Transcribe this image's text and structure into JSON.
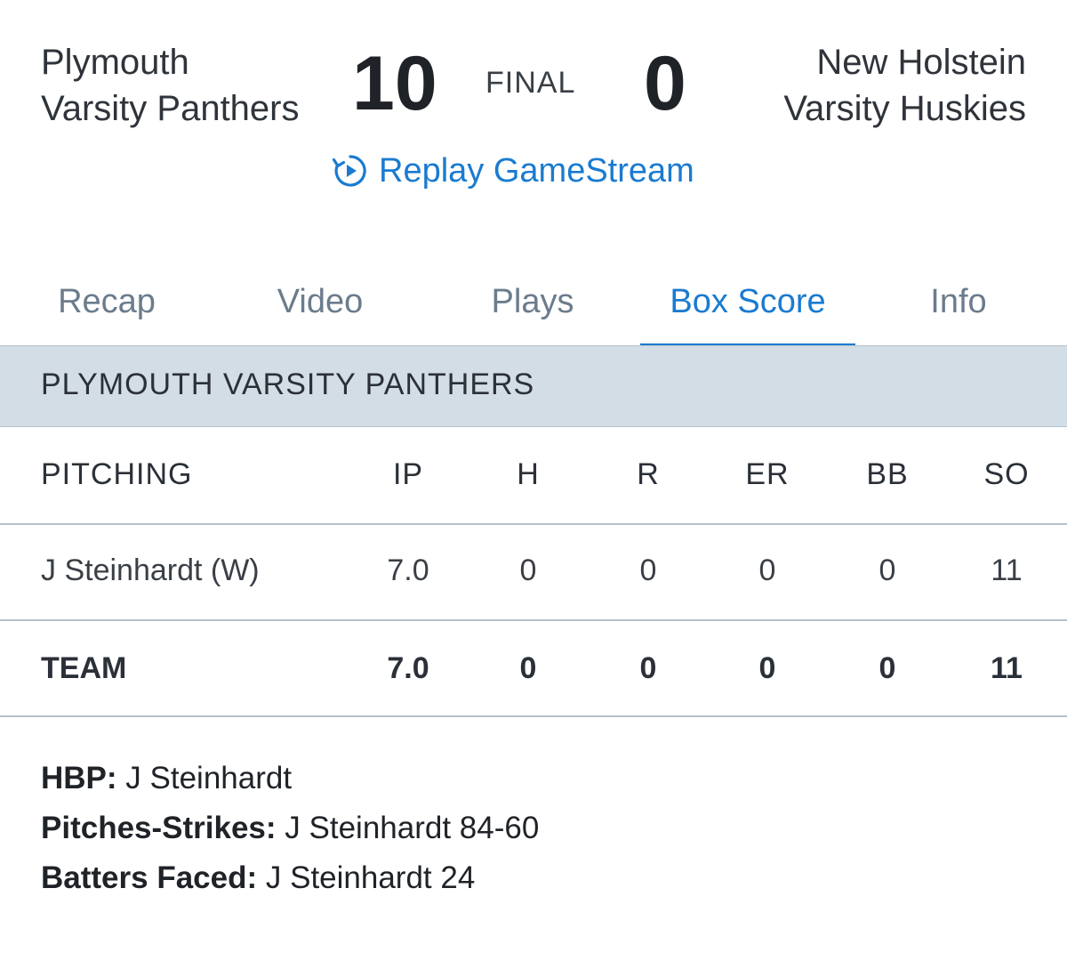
{
  "game": {
    "home": {
      "line1": "Plymouth",
      "line2": "Varsity Panthers",
      "score": "10"
    },
    "away": {
      "line1": "New Holstein",
      "line2": "Varsity Huskies",
      "score": "0"
    },
    "status": "FINAL",
    "replay_label": "Replay GameStream",
    "replay_icon": "replay-icon"
  },
  "tabs": [
    {
      "label": "Recap",
      "active": false
    },
    {
      "label": "Video",
      "active": false
    },
    {
      "label": "Plays",
      "active": false
    },
    {
      "label": "Box Score",
      "active": true
    },
    {
      "label": "Info",
      "active": false
    }
  ],
  "colors": {
    "accent": "#1a7bd0",
    "band": "#d2dde6",
    "tab_inactive": "#6b7c8c"
  },
  "box_score": {
    "team_name": "PLYMOUTH VARSITY PANTHERS",
    "section_label": "PITCHING",
    "columns": [
      "IP",
      "H",
      "R",
      "ER",
      "BB",
      "SO"
    ],
    "rows": [
      {
        "name": "J Steinhardt (W)",
        "values": [
          "7.0",
          "0",
          "0",
          "0",
          "0",
          "11"
        ]
      }
    ],
    "team_row": {
      "name": "TEAM",
      "values": [
        "7.0",
        "0",
        "0",
        "0",
        "0",
        "11"
      ]
    }
  },
  "notes": [
    {
      "key": "HBP:",
      "value": "J Steinhardt"
    },
    {
      "key": "Pitches-Strikes:",
      "value": "J Steinhardt 84-60"
    },
    {
      "key": "Batters Faced:",
      "value": "J Steinhardt 24"
    }
  ]
}
